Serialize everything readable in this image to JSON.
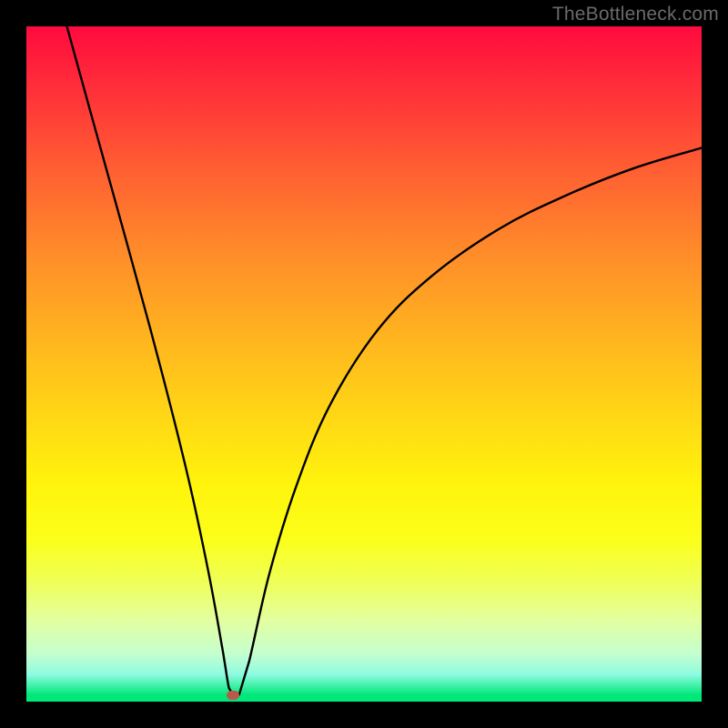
{
  "watermark": "TheBottleneck.com",
  "marker": {
    "x_pct": 30.6,
    "y_pct": 99.0,
    "color": "#b85a4a"
  },
  "chart_data": {
    "type": "line",
    "title": "",
    "xlabel": "",
    "ylabel": "",
    "xlim": [
      0,
      100
    ],
    "ylim": [
      0,
      100
    ],
    "grid": false,
    "legend": false,
    "background_gradient": {
      "direction": "vertical",
      "stops": [
        {
          "pos": 0.0,
          "color": "#ff0a3e"
        },
        {
          "pos": 0.2,
          "color": "#ff5a33"
        },
        {
          "pos": 0.46,
          "color": "#ffd815"
        },
        {
          "pos": 0.76,
          "color": "#fbff1a"
        },
        {
          "pos": 0.93,
          "color": "#c4ffd0"
        },
        {
          "pos": 1.0,
          "color": "#00e87a"
        }
      ]
    },
    "curve": {
      "description": "V-shaped bottleneck curve; minimum near x≈30.6",
      "points": [
        {
          "x": 6.0,
          "y": 100.0
        },
        {
          "x": 10.0,
          "y": 85.5
        },
        {
          "x": 15.0,
          "y": 67.5
        },
        {
          "x": 20.0,
          "y": 49.0
        },
        {
          "x": 24.0,
          "y": 33.0
        },
        {
          "x": 27.0,
          "y": 19.0
        },
        {
          "x": 29.0,
          "y": 8.0
        },
        {
          "x": 30.0,
          "y": 2.0
        },
        {
          "x": 30.6,
          "y": 1.0
        },
        {
          "x": 31.5,
          "y": 1.0
        },
        {
          "x": 33.0,
          "y": 6.0
        },
        {
          "x": 36.0,
          "y": 19.0
        },
        {
          "x": 40.0,
          "y": 32.0
        },
        {
          "x": 45.0,
          "y": 44.0
        },
        {
          "x": 52.0,
          "y": 55.0
        },
        {
          "x": 60.0,
          "y": 63.0
        },
        {
          "x": 70.0,
          "y": 70.0
        },
        {
          "x": 80.0,
          "y": 75.0
        },
        {
          "x": 90.0,
          "y": 79.0
        },
        {
          "x": 100.0,
          "y": 82.0
        }
      ]
    },
    "marker_point": {
      "x": 30.6,
      "y": 1.0
    }
  }
}
